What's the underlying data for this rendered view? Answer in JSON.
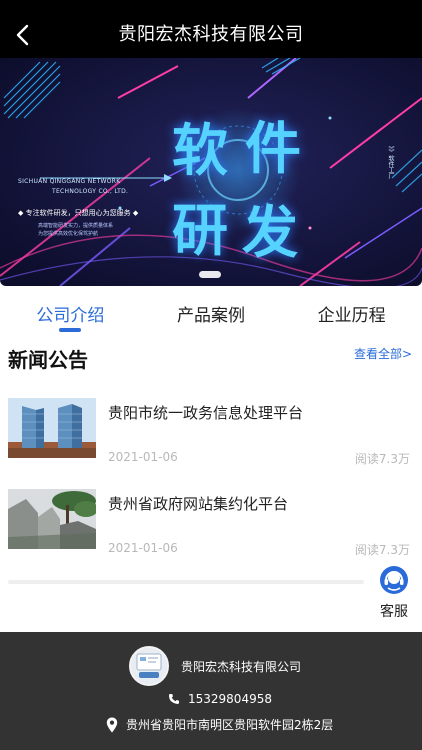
{
  "header": {
    "title": "贵阳宏杰科技有限公司",
    "back_icon": "chevron-left-icon"
  },
  "banner": {
    "headline_chars": [
      "软",
      "件",
      "研",
      "发"
    ],
    "company_en_line1": "SICHUAN QINGGANG NETWORK",
    "company_en_line2": "TECHNOLOGY CO., LTD.",
    "slogan": "◆ 专注软件研发，只想用心为您服务 ◆",
    "sub_line1": "高端智能研发实力，提供质量体系",
    "sub_line2": "为您提供高效优化保驾护航",
    "side_text": "》》软件工厂"
  },
  "tabs": [
    {
      "label": "公司介绍",
      "active": true
    },
    {
      "label": "产品案例",
      "active": false
    },
    {
      "label": "企业历程",
      "active": false
    }
  ],
  "news": {
    "section_title": "新闻公告",
    "view_all": "查看全部>",
    "items": [
      {
        "title": "贵阳市统一政务信息处理平台",
        "date": "2021-01-06",
        "reads": "阅读7.3万"
      },
      {
        "title": "贵州省政府网站集约化平台",
        "date": "2021-01-06",
        "reads": "阅读7.3万"
      }
    ]
  },
  "customer_service": {
    "label": "客服",
    "icon": "headset-icon"
  },
  "footer": {
    "company": "贵阳宏杰科技有限公司",
    "phone": "15329804958",
    "address": "贵州省贵阳市南明区贵阳软件园2栋2层"
  },
  "colors": {
    "accent": "#2a6bd9",
    "topbar": "#000000",
    "footer": "#333333",
    "banner_bg": "#14143a"
  }
}
